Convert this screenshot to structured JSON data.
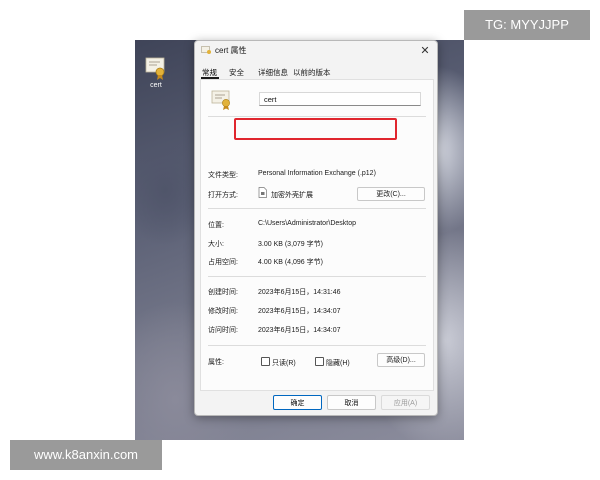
{
  "watermarks": {
    "top": "TG: MYYJJPP",
    "bottom": "www.k8anxin.com"
  },
  "desktop_icon": {
    "label": "cert",
    "icon": "certificate-icon"
  },
  "dialog": {
    "title": "cert 属性",
    "close": "✕",
    "tabs": [
      {
        "label": "常规",
        "active": true
      },
      {
        "label": "安全"
      },
      {
        "label": "详细信息"
      },
      {
        "label": "以前的版本"
      }
    ],
    "file_name": "cert",
    "file_type": {
      "label": "文件类型:",
      "value": "Personal Information Exchange (.p12)"
    },
    "opens_with": {
      "label": "打开方式:",
      "value": "加密外壳扩展",
      "button": "更改(C)..."
    },
    "location": {
      "label": "位置:",
      "value": "C:\\Users\\Administrator\\Desktop"
    },
    "size": {
      "label": "大小:",
      "value": "3.00 KB (3,079 字节)"
    },
    "size_on_disk": {
      "label": "占用空间:",
      "value": "4.00 KB (4,096 字节)"
    },
    "created": {
      "label": "创建时间:",
      "value": "2023年6月15日，14:31:46"
    },
    "modified": {
      "label": "修改时间:",
      "value": "2023年6月15日，14:34:07"
    },
    "accessed": {
      "label": "访问时间:",
      "value": "2023年6月15日，14:34:07"
    },
    "attributes": {
      "label": "属性:",
      "readonly": "只读(R)",
      "hidden": "隐藏(H)",
      "advanced": "高级(D)..."
    },
    "buttons": {
      "ok": "确定",
      "cancel": "取消",
      "apply": "应用(A)"
    }
  },
  "colors": {
    "highlight": "#e0262e",
    "accent": "#0067c0",
    "watermark_bg": "#9a9a9a"
  }
}
